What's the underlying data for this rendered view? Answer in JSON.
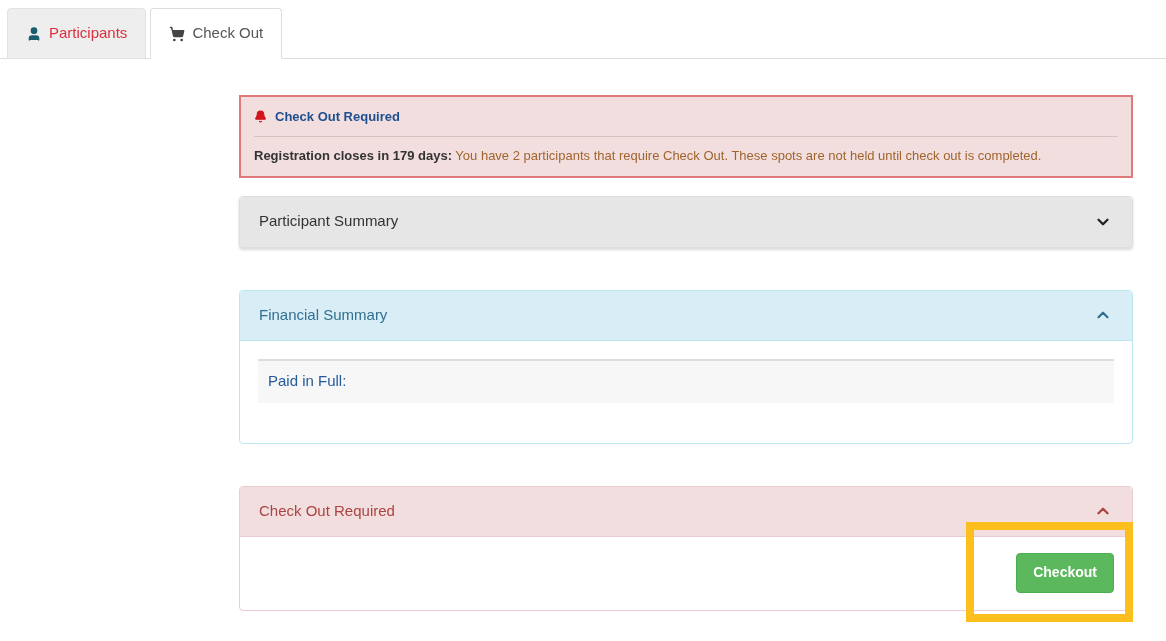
{
  "tabs": [
    {
      "label": "Participants",
      "kind": "person",
      "selected": false
    },
    {
      "label": "Check Out",
      "kind": "cart",
      "selected": true
    }
  ],
  "alert": {
    "title": "Check Out Required",
    "message": "**Registration closes in 179 days:** You have 2 participants that require Check Out. These spots are not held until check out is completed."
  },
  "panels": [
    {
      "kind": "default",
      "title": "Participant Summary",
      "expanded": false
    },
    {
      "kind": "info",
      "title": "Financial Summary",
      "expanded": true,
      "rows": [
        "Paid in Full:"
      ]
    },
    {
      "kind": "danger",
      "title": "Check Out Required",
      "expanded": true,
      "button": "Checkout"
    }
  ]
}
